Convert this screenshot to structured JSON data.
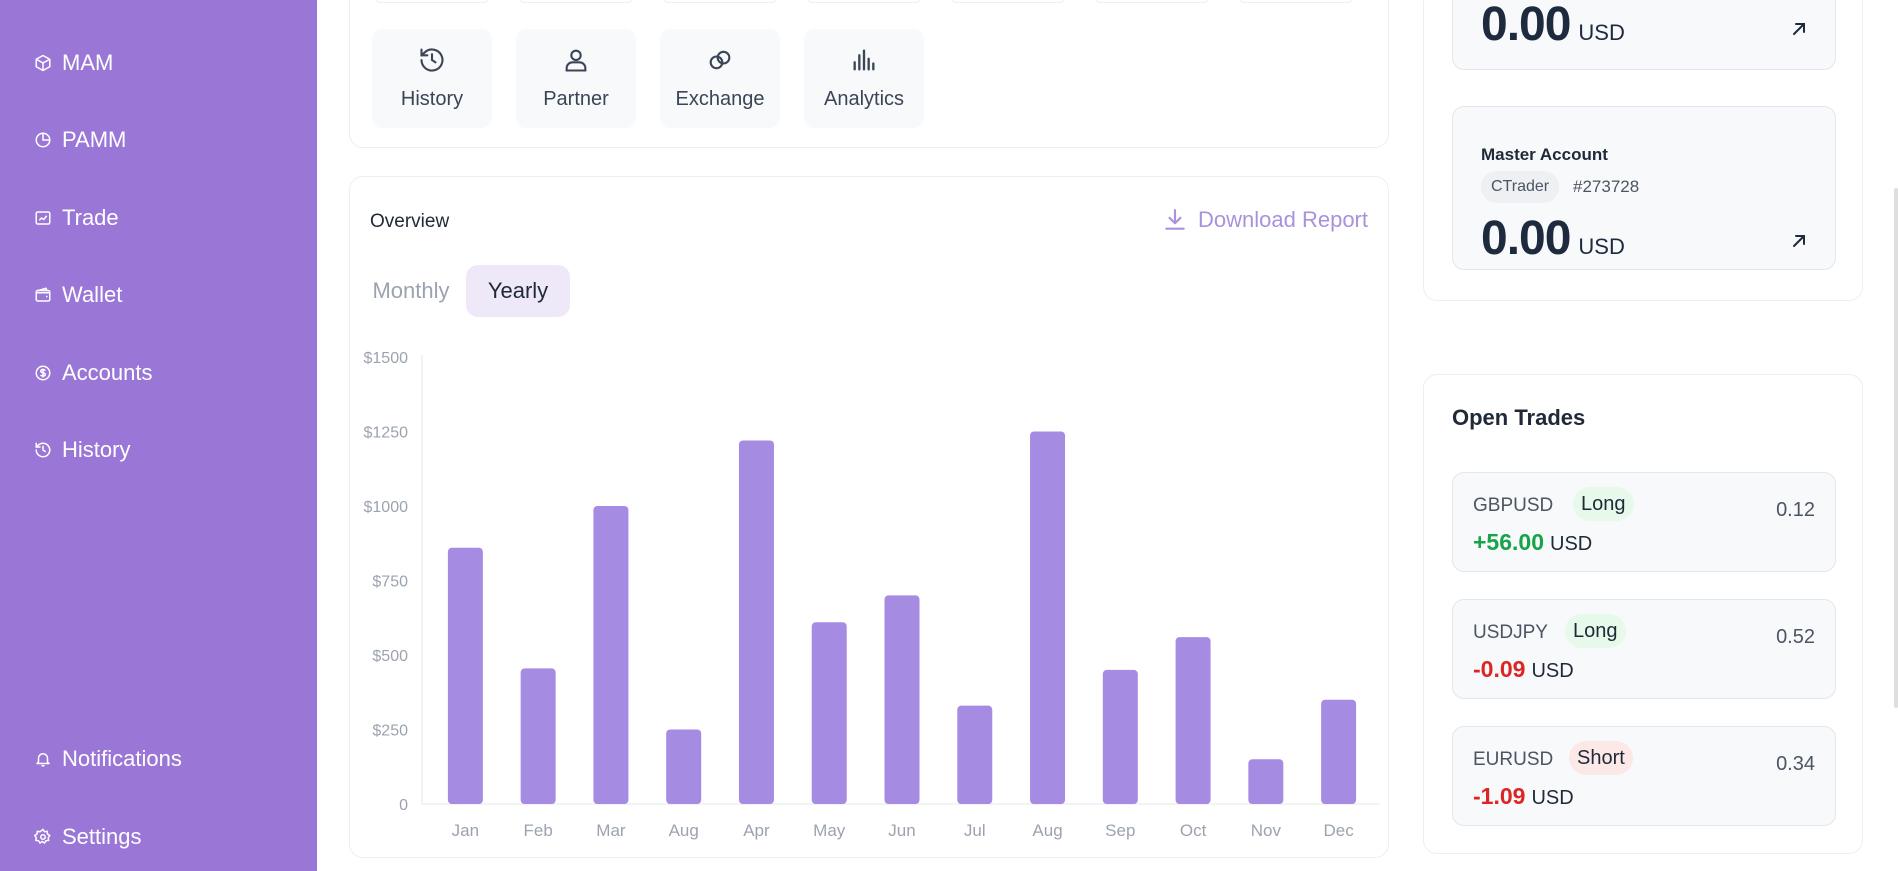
{
  "colors": {
    "sidebar_bg": "#9a77d6",
    "bar": "#a68be3",
    "accent": "#a992dc",
    "positive": "#16a34a",
    "negative": "#dc2626"
  },
  "sidebar": {
    "items": [
      {
        "label": "MAM",
        "icon": "cube-icon"
      },
      {
        "label": "PAMM",
        "icon": "pie-chart-icon"
      },
      {
        "label": "Trade",
        "icon": "trade-chart-icon"
      },
      {
        "label": "Wallet",
        "icon": "wallet-icon"
      },
      {
        "label": "Accounts",
        "icon": "dollar-circle-icon"
      },
      {
        "label": "History",
        "icon": "history-icon"
      }
    ],
    "bottom_items": [
      {
        "label": "Notifications",
        "icon": "bell-icon"
      },
      {
        "label": "Settings",
        "icon": "gear-icon"
      }
    ]
  },
  "quick_actions": [
    {
      "label": "History",
      "icon": "history-icon"
    },
    {
      "label": "Partner",
      "icon": "user-icon"
    },
    {
      "label": "Exchange",
      "icon": "exchange-icon"
    },
    {
      "label": "Analytics",
      "icon": "analytics-icon"
    }
  ],
  "overview": {
    "title": "Overview",
    "download_label": "Download Report",
    "tabs": {
      "monthly": "Monthly",
      "yearly": "Yearly",
      "active": "Yearly"
    }
  },
  "chart_data": {
    "type": "bar",
    "categories": [
      "Jan",
      "Feb",
      "Mar",
      "Aug",
      "Apr",
      "May",
      "Jun",
      "Jul",
      "Aug",
      "Sep",
      "Oct",
      "Nov",
      "Dec"
    ],
    "values": [
      860,
      455,
      1000,
      250,
      1220,
      610,
      700,
      330,
      1250,
      450,
      560,
      150,
      350
    ],
    "y_ticks": [
      "0",
      "$250",
      "$500",
      "$750",
      "$1000",
      "$1250",
      "$1500"
    ],
    "ylim": [
      0,
      1500
    ],
    "title": "",
    "xlabel": "",
    "ylabel": "",
    "grid": false
  },
  "accounts": [
    {
      "name": "",
      "amount": "0.00",
      "currency": "USD"
    },
    {
      "name": "Master Account",
      "platform": "CTrader",
      "number": "#273728",
      "amount": "0.00",
      "currency": "USD"
    }
  ],
  "open_trades": {
    "title": "Open Trades",
    "items": [
      {
        "pair": "GBPUSD",
        "side": "Long",
        "pnl": "+56.00",
        "currency": "USD",
        "volume": "0.12",
        "direction": "positive"
      },
      {
        "pair": "USDJPY",
        "side": "Long",
        "pnl": "-0.09",
        "currency": "USD",
        "volume": "0.52",
        "direction": "negative"
      },
      {
        "pair": "EURUSD",
        "side": "Short",
        "pnl": "-1.09",
        "currency": "USD",
        "volume": "0.34",
        "direction": "negative"
      }
    ]
  }
}
